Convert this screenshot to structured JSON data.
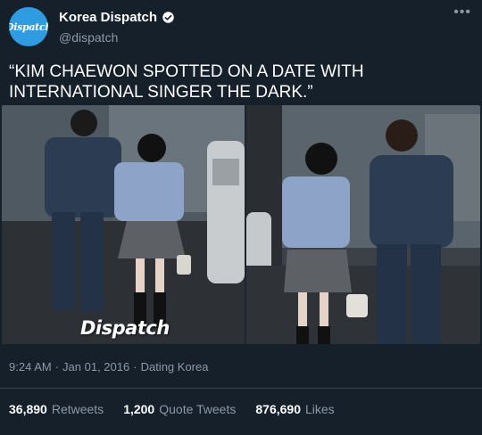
{
  "account": {
    "display_name": "Korea Dispatch",
    "handle": "@dispatch",
    "avatar_text": "Dispatch",
    "verified": true
  },
  "menu": {
    "more_label": "•••"
  },
  "tweet": {
    "text": "“KIM CHAEWON SPOTTED ON A DATE WITH INTERNATIONAL SINGER THE DARK.”"
  },
  "media": {
    "watermark": "Dispatch"
  },
  "meta": {
    "time": "9:24 AM",
    "sep1": "·",
    "date": "Jan 01, 2016",
    "sep2": "·",
    "source": "Dating Korea"
  },
  "stats": {
    "retweets_count": "36,890",
    "retweets_label": "Retweets",
    "quotes_count": "1,200",
    "quotes_label": "Quote Tweets",
    "likes_count": "876,690",
    "likes_label": "Likes"
  },
  "colors": {
    "background": "#15202b",
    "secondary_text": "#8b98a5",
    "avatar_blue": "#2f9be0",
    "divider": "#38444d"
  }
}
